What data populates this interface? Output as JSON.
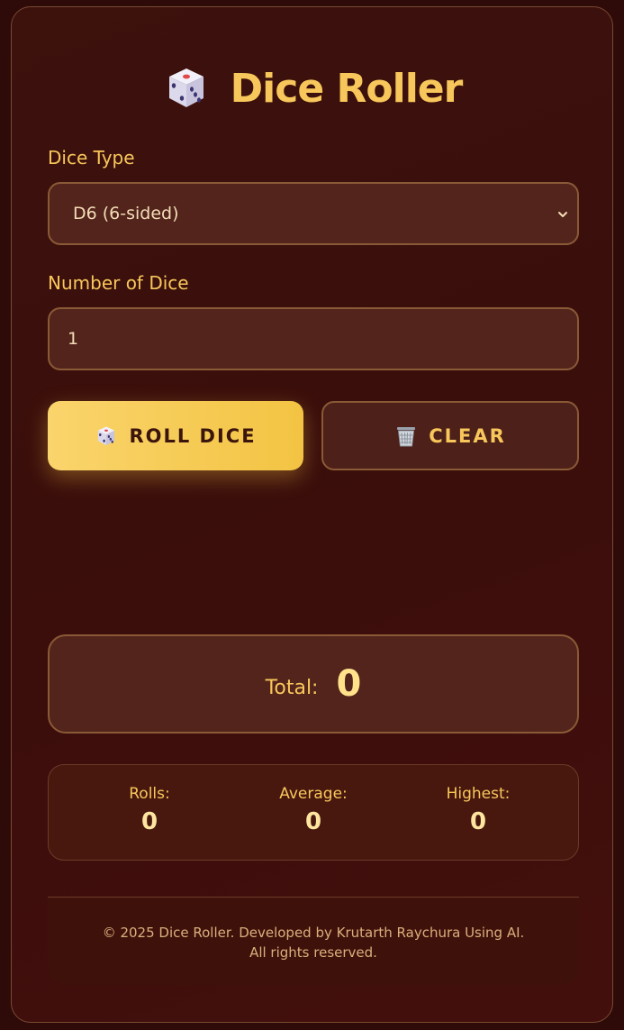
{
  "header": {
    "title": "Dice Roller",
    "icon": "dice-icon"
  },
  "dice_type": {
    "label": "Dice Type",
    "selected": "D6 (6-sided)"
  },
  "dice_count": {
    "label": "Number of Dice",
    "value": "1"
  },
  "actions": {
    "roll_label": "ROLL DICE",
    "roll_icon": "dice-icon",
    "clear_label": "CLEAR",
    "clear_icon": "wastebasket-icon"
  },
  "total": {
    "label": "Total:",
    "value": "0"
  },
  "stats": [
    {
      "label": "Rolls:",
      "value": "0"
    },
    {
      "label": "Average:",
      "value": "0"
    },
    {
      "label": "Highest:",
      "value": "0"
    }
  ],
  "footer": {
    "text": "© 2025 Dice Roller. Developed by Krutarth Raychura Using AI. All rights reserved."
  },
  "colors": {
    "accent": "#f8c75b",
    "background": "#3a0e0b",
    "panel": "#52241c"
  }
}
